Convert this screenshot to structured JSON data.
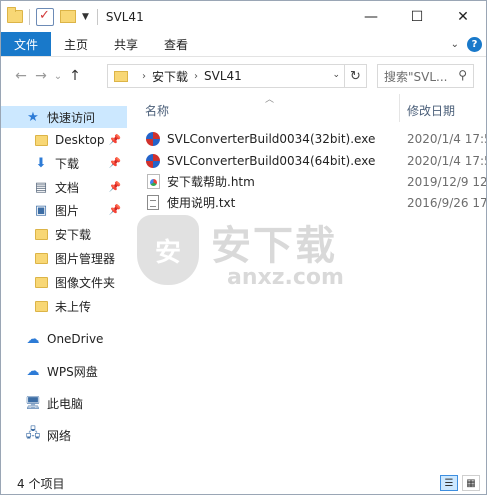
{
  "window": {
    "title": "SVL41"
  },
  "window_controls": {
    "minimize": "—",
    "maximize": "☐",
    "close": "✕"
  },
  "ribbon": {
    "tabs": [
      {
        "label": "文件"
      },
      {
        "label": "主页"
      },
      {
        "label": "共享"
      },
      {
        "label": "查看"
      }
    ],
    "expand": "⌄",
    "help": "?"
  },
  "nav": {
    "back": "←",
    "forward": "→",
    "recent": "⌄",
    "up": "↑",
    "breadcrumbs": [
      "安下载",
      "SVL41"
    ],
    "refresh": "↻",
    "search_placeholder": "搜索\"SVL..."
  },
  "sidebar": {
    "items": [
      {
        "label": "快速访问"
      },
      {
        "label": "Desktop"
      },
      {
        "label": "下载"
      },
      {
        "label": "文档"
      },
      {
        "label": "图片"
      },
      {
        "label": "安下载"
      },
      {
        "label": "图片管理器"
      },
      {
        "label": "图像文件夹"
      },
      {
        "label": "未上传"
      },
      {
        "label": "OneDrive"
      },
      {
        "label": "WPS网盘"
      },
      {
        "label": "此电脑"
      },
      {
        "label": "网络"
      }
    ]
  },
  "columns": {
    "name": "名称",
    "date": "修改日期"
  },
  "files": [
    {
      "name": "SVLConverterBuild0034(32bit).exe",
      "date": "2020/1/4 17:5",
      "type": "exe"
    },
    {
      "name": "SVLConverterBuild0034(64bit).exe",
      "date": "2020/1/4 17:5",
      "type": "exe"
    },
    {
      "name": "安下载帮助.htm",
      "date": "2019/12/9 12:",
      "type": "htm"
    },
    {
      "name": "使用说明.txt",
      "date": "2016/9/26 17:",
      "type": "txt"
    }
  ],
  "watermark": {
    "shield": "安",
    "cn": "安下载",
    "en": "anxz.com"
  },
  "status": {
    "count": "4 个项目"
  },
  "colors": {
    "accent": "#1979ca",
    "selection": "#cce8ff"
  }
}
